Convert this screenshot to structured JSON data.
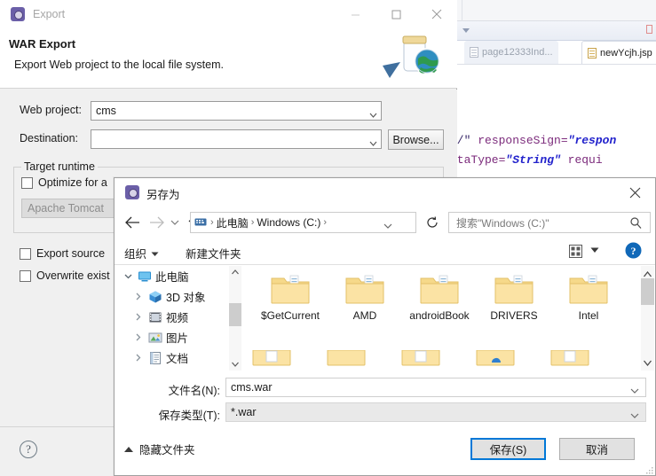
{
  "ide": {
    "tabs": [
      {
        "label": "page12333Ind...",
        "icon": "document-icon",
        "active": false
      },
      {
        "label": "newYcjh.jsp",
        "icon": "document-icon",
        "active": true
      }
    ],
    "code_lines": [
      {
        "segments": [
          {
            "text": "&/\" ",
            "cls": "c-plain"
          },
          {
            "text": "responseSign=",
            "cls": "c-attr"
          },
          {
            "text": "\"respon",
            "cls": "c-val"
          }
        ]
      },
      {
        "segments": [
          {
            "text": "ataType=",
            "cls": "c-attr"
          },
          {
            "text": "\"String\"",
            "cls": "c-val"
          },
          {
            "text": " requi",
            "cls": "c-attr"
          }
        ]
      }
    ]
  },
  "export_dialog": {
    "title": "Export",
    "title_icon": "eclipse-export-icon",
    "heading": "WAR Export",
    "subheading": "Export Web project to the local file system.",
    "graphic": "war-jar-globe-icon",
    "window_buttons": [
      {
        "name": "minimize-button",
        "glyph": "minimize"
      },
      {
        "name": "maximize-button",
        "glyph": "maximize"
      },
      {
        "name": "close-button",
        "glyph": "close"
      }
    ],
    "fields": {
      "web_project_label": "Web project:",
      "web_project_value": "cms",
      "destination_label": "Destination:",
      "destination_value": "",
      "destination_placeholder": "",
      "browse_label": "Browse..."
    },
    "target_runtime": {
      "group_title": "Target runtime",
      "optimize_label": "Optimize for a",
      "optimize_checked": false,
      "runtime_value": "Apache Tomcat "
    },
    "options": [
      {
        "label": "Export source ",
        "checked": false
      },
      {
        "label": "Overwrite exist",
        "checked": false
      }
    ],
    "help_glyph": "?"
  },
  "save_as_dialog": {
    "title": "另存为",
    "title_icon": "save-as-icon",
    "close_label": "✕",
    "nav": {
      "back_icon": "arrow-left-icon",
      "forward_icon": "arrow-right-icon",
      "recent_icon": "chevron-down-icon",
      "up_icon": "arrow-up-icon",
      "breadcrumb_root_icon": "drive-icon",
      "breadcrumb": [
        "此电脑",
        "Windows (C:)"
      ],
      "breadcrumb_caret": "chevron-down-icon",
      "refresh_icon": "refresh-icon",
      "search_placeholder": "搜索\"Windows (C:)\"",
      "search_icon": "search-icon"
    },
    "toolbar": {
      "organize_label": "组织",
      "organize_caret": "chevron-down-icon",
      "new_folder_label": "新建文件夹",
      "view_icon": "view-tiles-icon",
      "view_caret": "chevron-down-icon",
      "help_icon": "help-circle-icon"
    },
    "tree": [
      {
        "label": "此电脑",
        "icon": "computer-icon",
        "expanded": true,
        "indent": 0
      },
      {
        "label": "3D 对象",
        "icon": "3d-objects-icon",
        "expanded": false,
        "indent": 1
      },
      {
        "label": "视频",
        "icon": "videos-icon",
        "expanded": false,
        "indent": 1
      },
      {
        "label": "图片",
        "icon": "pictures-icon",
        "expanded": false,
        "indent": 1
      },
      {
        "label": "文档",
        "icon": "documents-icon",
        "expanded": false,
        "indent": 1
      }
    ],
    "files": [
      {
        "name": "$GetCurrent",
        "icon": "folder-icon"
      },
      {
        "name": "AMD",
        "icon": "folder-icon"
      },
      {
        "name": "androidBook",
        "icon": "folder-icon"
      },
      {
        "name": "DRIVERS",
        "icon": "folder-icon"
      },
      {
        "name": "Intel",
        "icon": "folder-icon"
      }
    ],
    "bottom": {
      "filename_label": "文件名(N):",
      "filename_value": "cms.war",
      "filetype_label": "保存类型(T):",
      "filetype_value": "*.war",
      "save_label": "保存(S)",
      "cancel_label": "取消",
      "hide_folders_label": "隐藏文件夹"
    }
  },
  "colors": {
    "accent": "#0078d7",
    "folder": "#f5d47f",
    "dialog_bg": "#f0f0f0",
    "code_attr": "#7b2a7b",
    "code_value": "#2222cc"
  }
}
